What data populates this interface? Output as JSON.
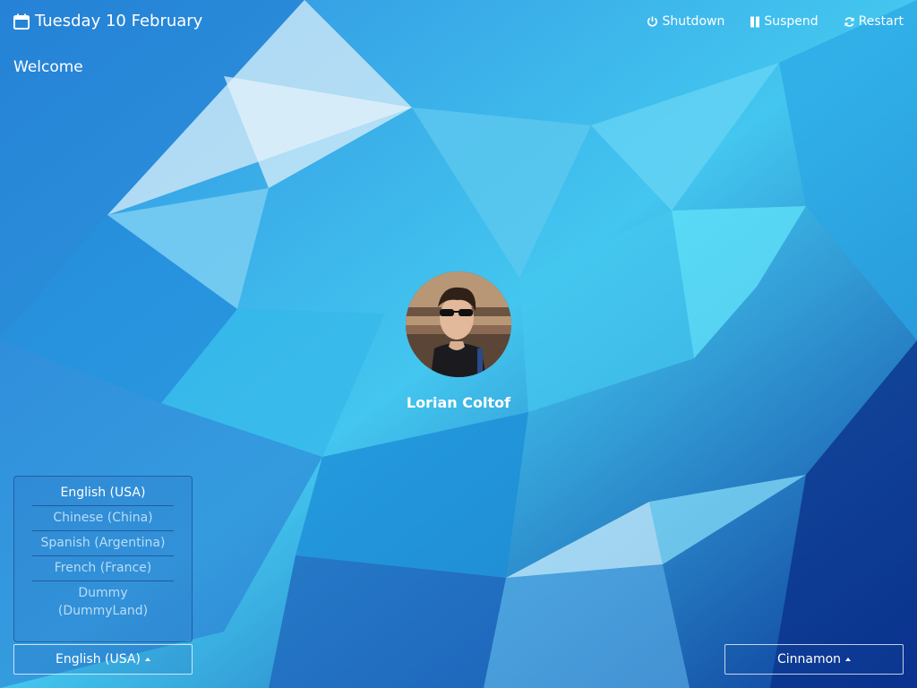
{
  "header": {
    "date": "Tuesday 10 February",
    "welcome": "Welcome"
  },
  "power": {
    "shutdown": "Shutdown",
    "suspend": "Suspend",
    "restart": "Restart"
  },
  "user": {
    "name": "Lorian Coltof"
  },
  "languages": {
    "items": [
      "English (USA)",
      "Chinese (China)",
      "Spanish (Argentina)",
      "French (France)",
      "Dummy (DummyLand)"
    ],
    "selected": "English (USA)"
  },
  "session": {
    "selected": "Cinnamon"
  },
  "icons": [
    "calendar-icon",
    "power-icon",
    "pause-icon",
    "refresh-icon",
    "caret-up-icon"
  ],
  "colors": {
    "background_accent": "#2a9be2",
    "text": "#ffffff",
    "inactive_text": "#b9dcf6"
  }
}
